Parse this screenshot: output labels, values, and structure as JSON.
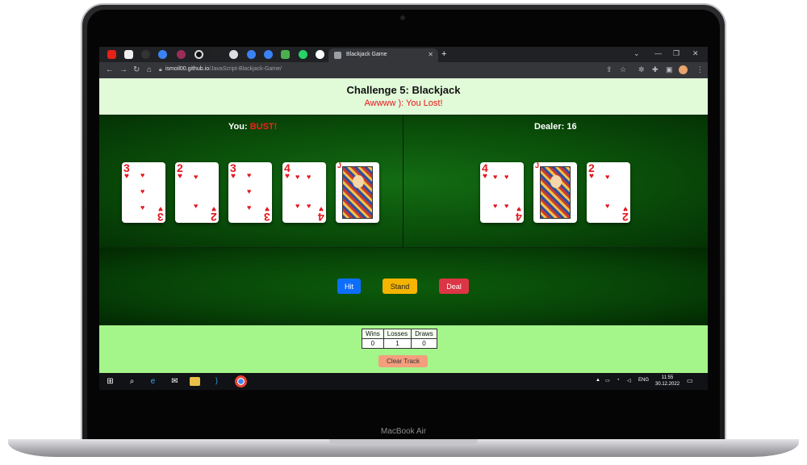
{
  "device": {
    "label": "MacBook Air"
  },
  "browser": {
    "active_tab_title": "Blackjack Game",
    "url_host": "ismoil00.github.io",
    "url_path": "/JavaScript-Blackjack-Game/",
    "new_tab_icon": "plus-icon"
  },
  "game": {
    "title": "Challenge 5: Blackjack",
    "result": "Awwww ): You Lost!",
    "you_label": "You: ",
    "you_score": "BUST!",
    "dealer_label": "Dealer: ",
    "dealer_score": "16",
    "your_cards": [
      {
        "rank": "3",
        "suit": "♥"
      },
      {
        "rank": "2",
        "suit": "♥"
      },
      {
        "rank": "3",
        "suit": "♥"
      },
      {
        "rank": "4",
        "suit": "♥"
      },
      {
        "rank": "J",
        "suit": "♥"
      }
    ],
    "dealer_cards": [
      {
        "rank": "4",
        "suit": "♥"
      },
      {
        "rank": "J",
        "suit": "♥"
      },
      {
        "rank": "2",
        "suit": "♥"
      }
    ],
    "buttons": {
      "hit": "Hit",
      "stand": "Stand",
      "deal": "Deal"
    },
    "scoreboard": {
      "headers": [
        "Wins",
        "Losses",
        "Draws"
      ],
      "values": [
        "0",
        "1",
        "0"
      ]
    },
    "clear_label": "Clear Track"
  },
  "taskbar": {
    "language": "ENG",
    "time": "11:55",
    "date": "30.12.2022"
  },
  "colors": {
    "felt": "#0a4e0a",
    "header_bg": "#e1fbd9",
    "footer_bg": "#a4f58a",
    "loss_red": "#e8141a"
  }
}
